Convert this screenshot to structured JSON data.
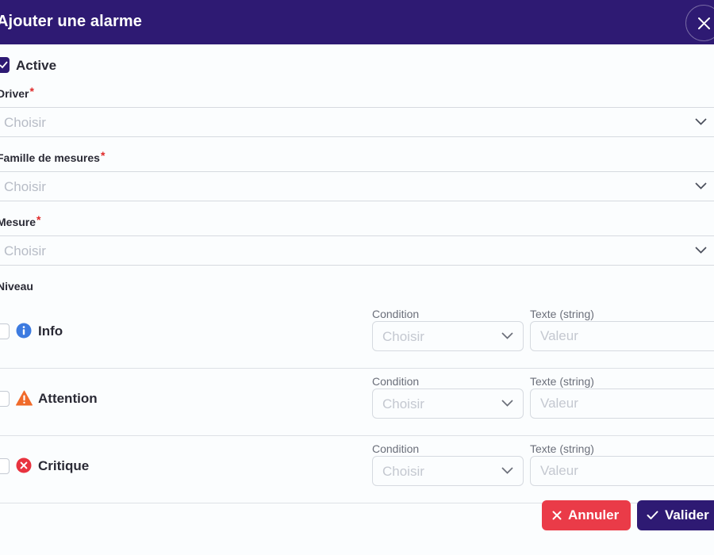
{
  "dialog": {
    "title": "Ajouter une alarme",
    "close_icon": "close-icon"
  },
  "active": {
    "label": "Active",
    "checked": true
  },
  "fields": {
    "driver": {
      "label": "Driver",
      "required_mark": "*",
      "placeholder": "Choisir"
    },
    "famille": {
      "label": "Famille de mesures",
      "required_mark": "*",
      "placeholder": "Choisir"
    },
    "mesure": {
      "label": "Mesure",
      "required_mark": "*",
      "placeholder": "Choisir"
    }
  },
  "niveau": {
    "label": "Niveau",
    "levels": [
      {
        "label": "Info",
        "icon": "info-icon",
        "color": "#3d7be0",
        "condition_label": "Condition",
        "condition_placeholder": "Choisir",
        "text_label": "Texte (string)",
        "text_placeholder": "Valeur"
      },
      {
        "label": "Attention",
        "icon": "warning-icon",
        "color": "#f06a2a",
        "condition_label": "Condition",
        "condition_placeholder": "Choisir",
        "text_label": "Texte (string)",
        "text_placeholder": "Valeur"
      },
      {
        "label": "Critique",
        "icon": "error-icon",
        "color": "#e8333f",
        "condition_label": "Condition",
        "condition_placeholder": "Choisir",
        "text_label": "Texte (string)",
        "text_placeholder": "Valeur"
      }
    ]
  },
  "actions": {
    "cancel_label": "Annuler",
    "ok_label": "Valider"
  },
  "colors": {
    "primary": "#2e1a73",
    "danger": "#ea3b48",
    "required": "#e02a2a"
  }
}
